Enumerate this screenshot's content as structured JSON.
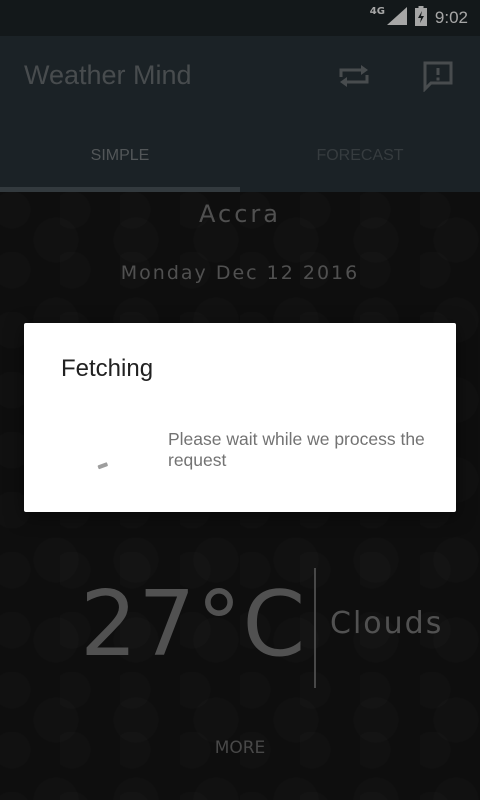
{
  "status_bar": {
    "network": "4G",
    "time": "9:02"
  },
  "app_bar": {
    "title": "Weather Mind",
    "refresh_icon": "refresh-icon",
    "feedback_icon": "feedback-icon"
  },
  "tabs": [
    {
      "label": "SIMPLE",
      "active": true
    },
    {
      "label": "FORECAST",
      "active": false
    }
  ],
  "weather": {
    "city": "Accra",
    "date": "Monday Dec 12 2016",
    "temperature": "27°C",
    "condition": "Clouds",
    "more_label": "MORE"
  },
  "dialog": {
    "title": "Fetching",
    "message": "Please wait while we process the request"
  }
}
